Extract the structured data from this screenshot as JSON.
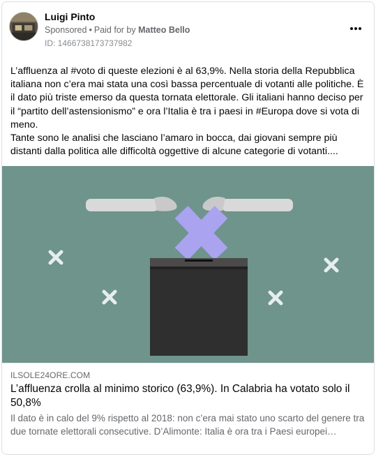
{
  "post": {
    "author": "Luigi Pinto",
    "sponsored_label": "Sponsored",
    "separator": "•",
    "paid_for_prefix": "Paid for by",
    "paid_for_name": "Matteo Bello",
    "ad_id": "ID: 1466738173737982",
    "avatar_icon": "avatar-photo",
    "more_icon": "more-options-icon",
    "body_paragraphs": [
      "L’affluenza al #voto di queste elezioni è al 63,9%. Nella storia della Repubblica italiana non c’era mai stata una così bassa percentuale di votanti alle politiche. È il dato più triste emerso da questa tornata elettorale. Gli italiani hanno deciso per il “partito dell’astensionismo” e ora l’Italia è tra i paesi in #Europa dove si vota di meno.",
      "Tante sono le analisi che lasciano l’amaro in bocca, dai giovani sempre più distanti dalla politica alle difficoltà oggettive di alcune categorie di votanti...."
    ]
  },
  "hero": {
    "background_color": "#6e948c",
    "cross_color": "#a9a3f0",
    "box_color": "#2b2b2b"
  },
  "link_preview": {
    "domain": "ILSOLE24ORE.COM",
    "title": "L’affluenza crolla al minimo storico (63,9%). In Calabria ha votato solo il 50,8%",
    "description": "Il dato è in calo del 9% rispetto al 2018: non c’era mai stato uno scarto del genere tra due tornate elettorali consecutive. D’Alimonte: Italia è ora tra i Paesi europei…"
  }
}
